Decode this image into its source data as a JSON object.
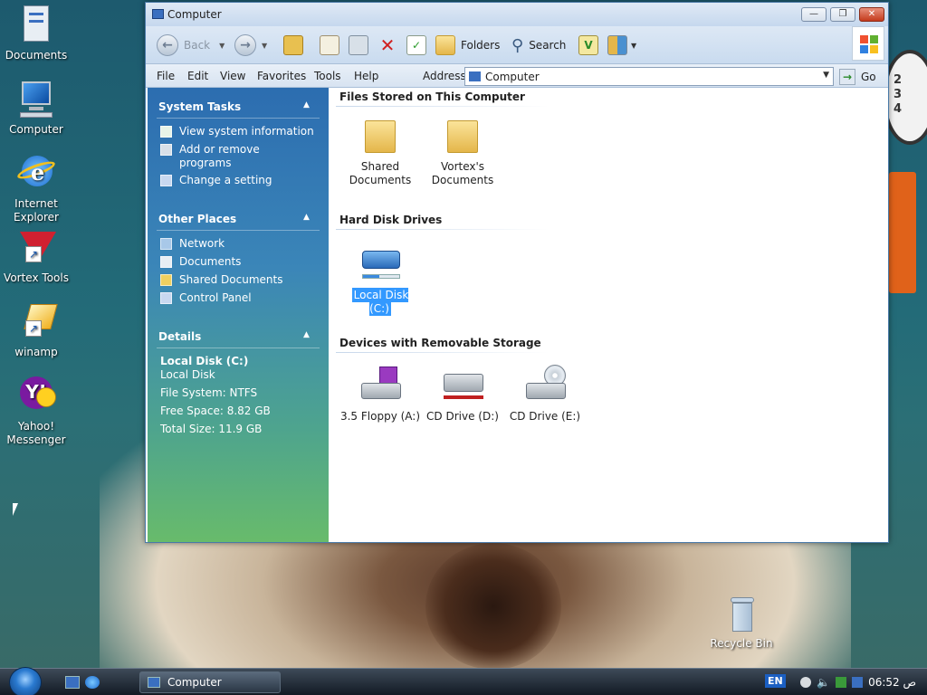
{
  "desktop": {
    "icons": [
      {
        "name": "documents",
        "label": "Documents",
        "icon": "documents-icon"
      },
      {
        "name": "computer",
        "label": "Computer",
        "icon": "computer-icon"
      },
      {
        "name": "internet-explorer",
        "label": "Internet Explorer",
        "icon": "ie-icon"
      },
      {
        "name": "vortex-tools",
        "label": "Vortex Tools",
        "icon": "vortex-icon"
      },
      {
        "name": "winamp",
        "label": "winamp",
        "icon": "winamp-icon"
      },
      {
        "name": "yahoo-messenger",
        "label": "Yahoo! Messenger",
        "icon": "yahoo-icon"
      },
      {
        "name": "recycle-bin",
        "label": "Recycle Bin",
        "icon": "recycle-bin-icon"
      }
    ]
  },
  "window": {
    "title": "Computer",
    "toolbar": {
      "back": "Back",
      "folders": "Folders",
      "search": "Search"
    },
    "menu": [
      "File",
      "Edit",
      "View",
      "Favorites",
      "Tools",
      "Help"
    ],
    "address": {
      "label": "Address",
      "value": "Computer",
      "go": "Go"
    },
    "sidebar": {
      "system_tasks": {
        "title": "System Tasks",
        "items": [
          "View system information",
          "Add or remove programs",
          "Change a setting"
        ]
      },
      "other_places": {
        "title": "Other Places",
        "items": [
          "Network",
          "Documents",
          "Shared Documents",
          "Control Panel"
        ]
      },
      "details": {
        "title": "Details",
        "lines": [
          "Local Disk (C:)",
          "Local Disk",
          "File System: NTFS",
          "Free Space: 8.82 GB",
          "Total Size: 11.9 GB"
        ]
      }
    },
    "content": {
      "groups": [
        {
          "title": "Files Stored on This Computer",
          "items": [
            "Shared Documents",
            "Vortex's Documents"
          ]
        },
        {
          "title": "Hard Disk Drives",
          "items": [
            "Local Disk (C:)"
          ]
        },
        {
          "title": "Devices with Removable Storage",
          "items": [
            "3.5 Floppy (A:)",
            "CD Drive (D:)",
            "CD Drive (E:)"
          ]
        }
      ]
    }
  },
  "taskbar": {
    "task_label": "Computer",
    "language": "EN",
    "clock": "06:52 ص"
  },
  "colors": {
    "accent": "#3399ff",
    "sidebar_top": "#2c6db0",
    "sidebar_bottom": "#68bb6b",
    "folder": "#e4b64a"
  }
}
